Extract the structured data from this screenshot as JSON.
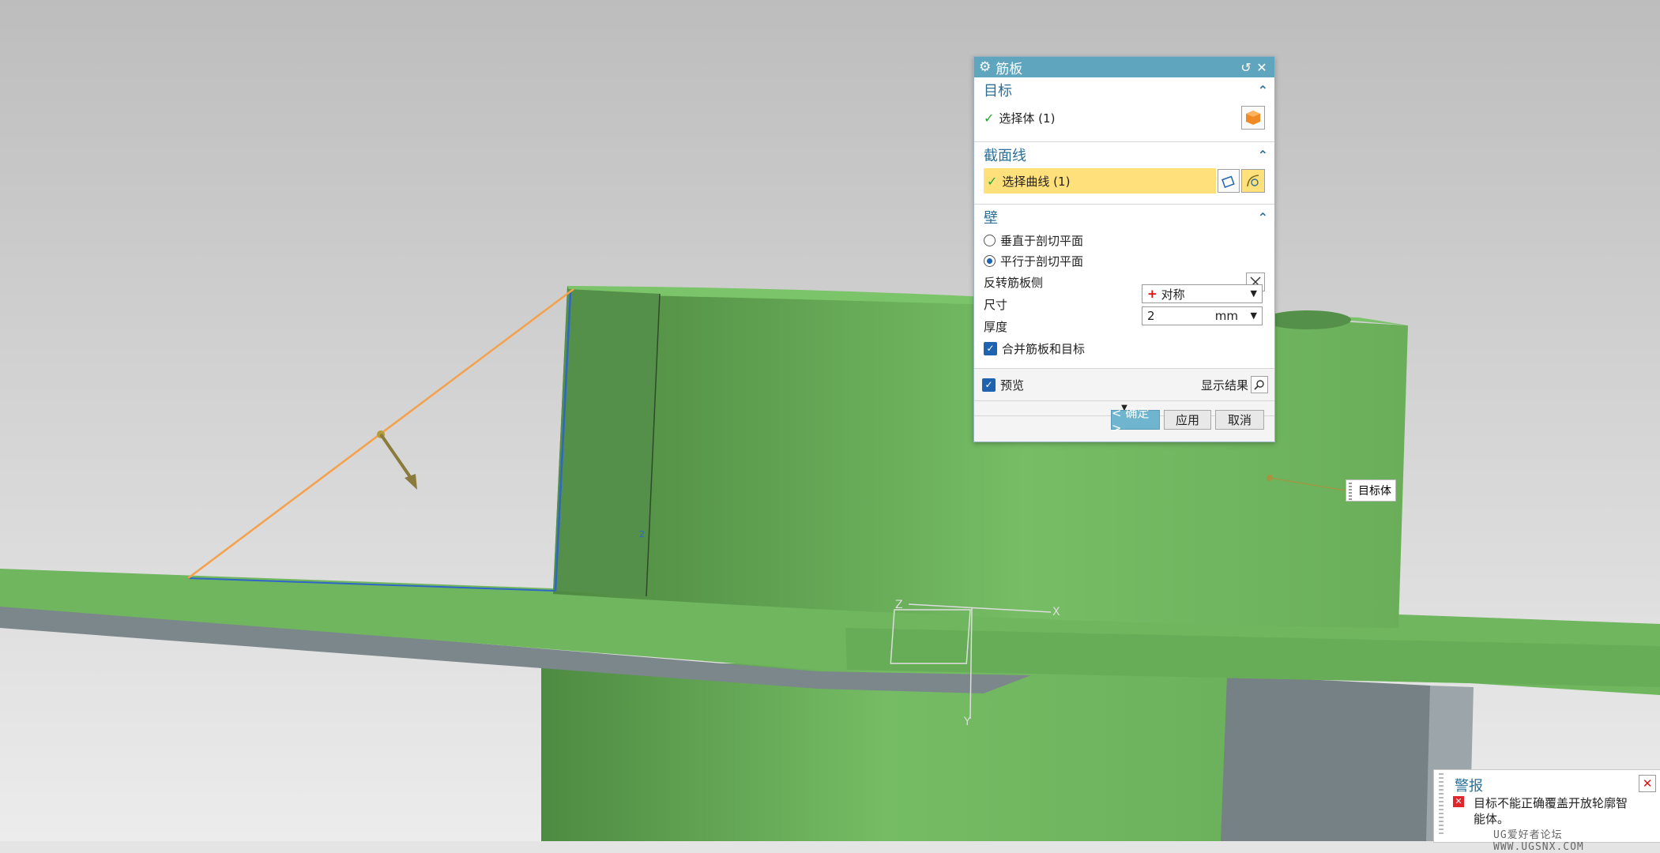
{
  "dialog": {
    "title": "筋板",
    "target_section": {
      "title": "目标",
      "select_label": "选择体 (1)"
    },
    "section_curve": {
      "title": "截面线",
      "select_label": "选择曲线 (1)"
    },
    "wall": {
      "title": "壁",
      "opt_perpendicular": "垂直于剖切平面",
      "opt_parallel": "平行于剖切平面",
      "selected_option": "平行于剖切平面",
      "reverse_label": "反转筋板侧",
      "size_label": "尺寸",
      "size_value": "对称",
      "thickness_label": "厚度",
      "thickness_value": "2",
      "thickness_unit": "mm",
      "merge_label": "合并筋板和目标",
      "merge_checked": true
    },
    "preview_label": "预览",
    "preview_checked": true,
    "show_result_label": "显示结果",
    "ok_label": "< 确定 >",
    "apply_label": "应用",
    "cancel_label": "取消"
  },
  "viewport": {
    "target_tag": "目标体",
    "section_dim": "2",
    "axis_x": "X",
    "axis_y": "Y",
    "axis_z": "Z"
  },
  "warning": {
    "title": "警报",
    "message": "目标不能正确覆盖开放轮廓智能体。"
  },
  "watermark": "UG爱好者论坛 WWW.UGSNX.COM",
  "colors": {
    "accent": "#5ea5bd",
    "part_green": "#6fb65f",
    "highlight": "#ffe07a"
  }
}
